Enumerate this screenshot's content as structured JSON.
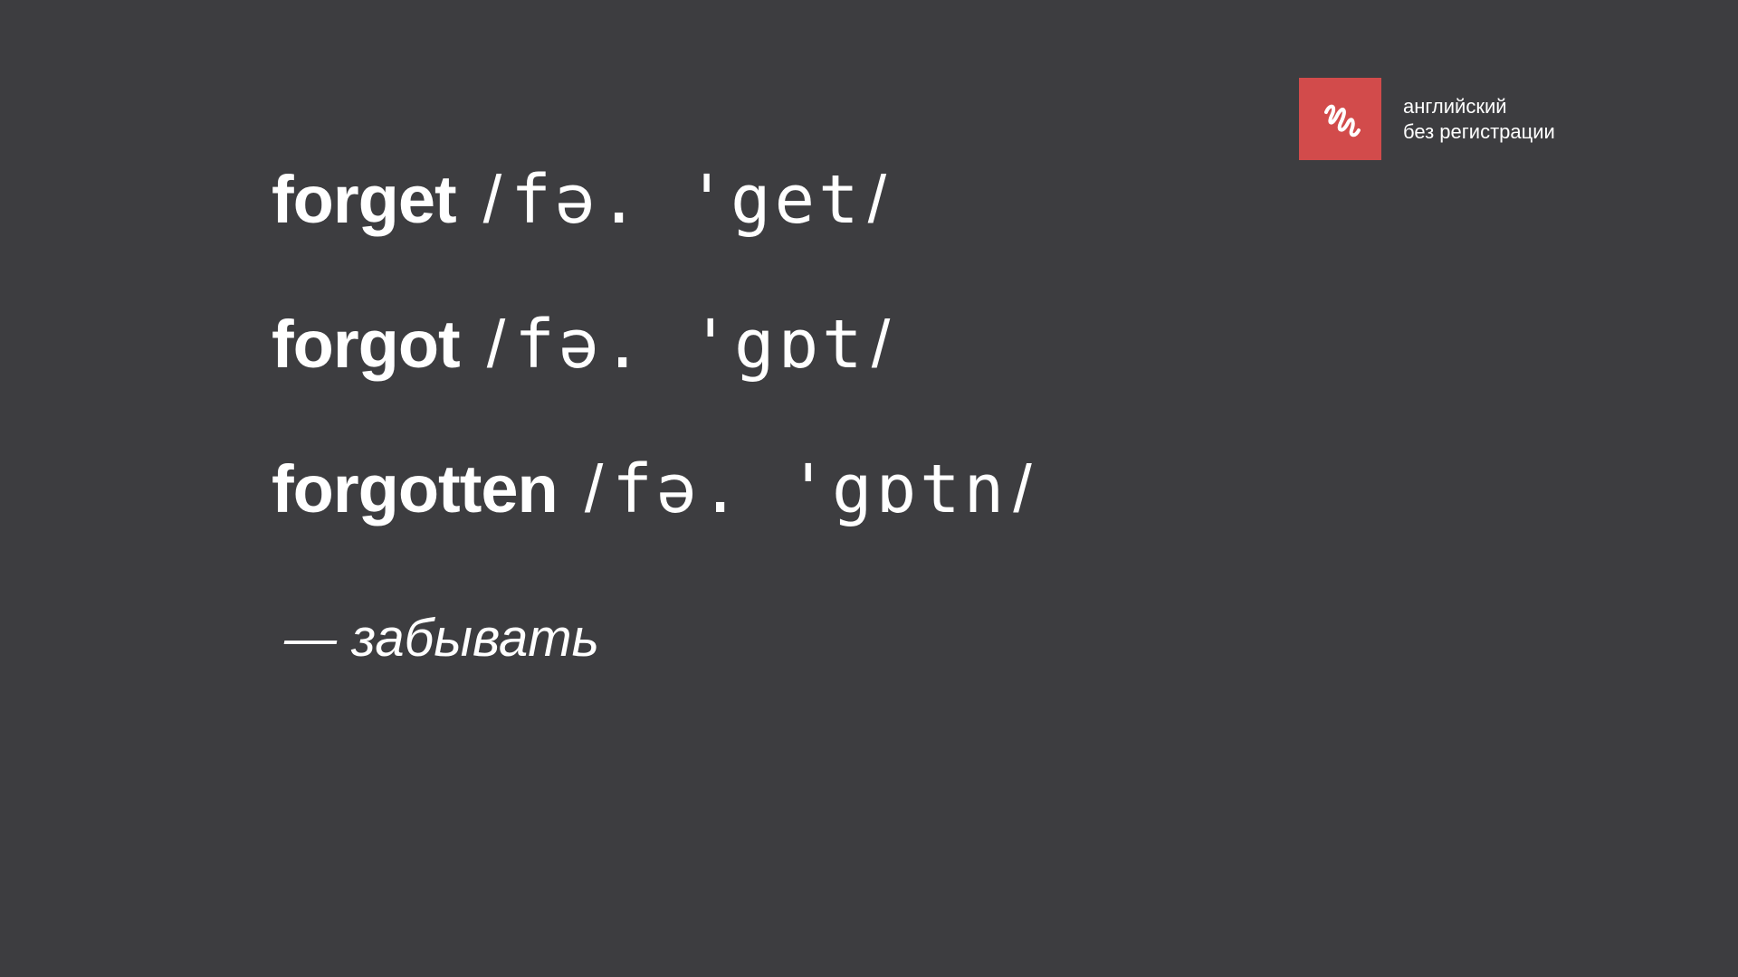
{
  "logo": {
    "icon": "scribble-icon",
    "accent_color": "#d24b4b",
    "line1": "английский",
    "line2": "без регистрации"
  },
  "rows": [
    {
      "word": "forget",
      "open_slash": "/",
      "ipa": "fə. 'get",
      "close_slash": "/"
    },
    {
      "word": "forgot",
      "open_slash": "/",
      "ipa": "fə. 'gɒt",
      "close_slash": "/"
    },
    {
      "word": "forgotten",
      "open_slash": "/",
      "ipa": "fə. 'gɒtn",
      "close_slash": "/"
    }
  ],
  "translation": "— забывать",
  "colors": {
    "background": "#3d3d40",
    "text": "#ffffff"
  }
}
